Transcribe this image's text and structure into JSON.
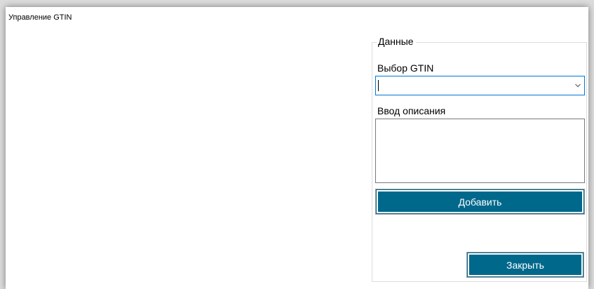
{
  "window": {
    "title": "Управление GTIN"
  },
  "group": {
    "legend": "Данные",
    "gtin_label": "Выбор GTIN",
    "gtin_value": "",
    "description_label": "Ввод описания",
    "description_value": "",
    "add_button": "Добавить",
    "close_button": "Закрыть"
  },
  "colors": {
    "button_bg": "#00688b",
    "focus_border": "#0078d7"
  },
  "icons": {
    "dropdown": "chevron-down-icon"
  }
}
